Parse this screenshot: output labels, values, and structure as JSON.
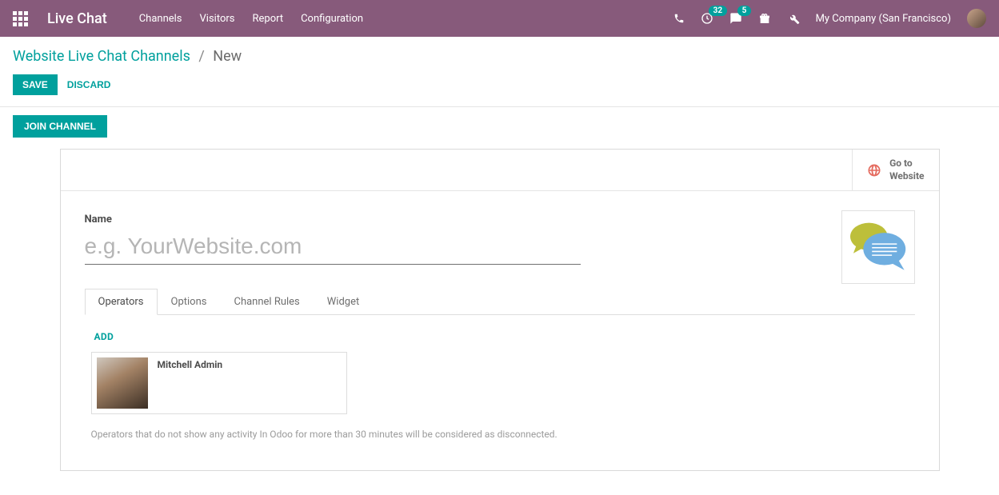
{
  "nav": {
    "brand": "Live Chat",
    "menu": [
      "Channels",
      "Visitors",
      "Report",
      "Configuration"
    ],
    "clock_badge": "32",
    "chat_badge": "5",
    "company": "My Company (San Francisco)"
  },
  "breadcrumb": {
    "root": "Website Live Chat Channels",
    "current": "New"
  },
  "actions": {
    "save": "SAVE",
    "discard": "DISCARD"
  },
  "join_channel": "JOIN CHANNEL",
  "go_web_line1": "Go to",
  "go_web_line2": "Website",
  "form": {
    "name_label": "Name",
    "name_placeholder": "e.g. YourWebsite.com",
    "name_value": ""
  },
  "tabs": [
    "Operators",
    "Options",
    "Channel Rules",
    "Widget"
  ],
  "active_tab_index": 0,
  "operators": {
    "add_label": "ADD",
    "items": [
      {
        "name": "Mitchell Admin"
      }
    ],
    "help": "Operators that do not show any activity In Odoo for more than 30 minutes will be considered as disconnected."
  }
}
